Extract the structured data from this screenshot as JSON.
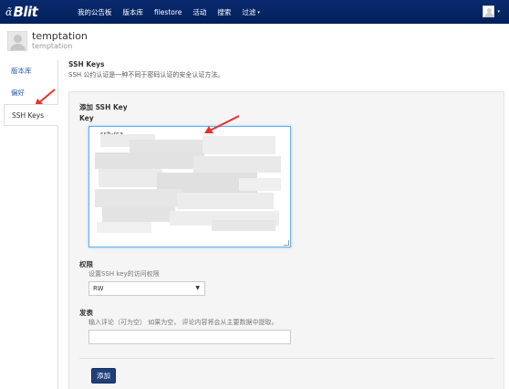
{
  "navbar": {
    "brand_mark": "ɑ̃",
    "brand_text": "Blit",
    "links": [
      "我的公告板",
      "版本库",
      "filestore",
      "活动",
      "搜索"
    ],
    "dropdown_label": "过滤",
    "caret": "▾"
  },
  "profile": {
    "name": "temptation",
    "subname": "temptation"
  },
  "sidenav": {
    "items": [
      "版本库",
      "偏好",
      "SSH Keys"
    ],
    "active_index": 2
  },
  "ssh": {
    "title": "SSH Keys",
    "description": "SSH 公约认证是一种不同于密码认证的安全认证方法。"
  },
  "form": {
    "card_title": "添加 SSH Key",
    "key_label": "Key",
    "key_value_visible": "ssh-rsa",
    "permission_label": "权限",
    "permission_hint": "设置SSH key的访问权限",
    "permission_value": "RW",
    "comment_label": "发表",
    "comment_hint": "输入评论（可为空） 如果为空， 评论内容将会从主要数据中提取。",
    "comment_value": "",
    "submit_label": "添加"
  },
  "colors": {
    "navbar": "#00205b",
    "accent_link": "#2a5db0",
    "button": "#1f3f7a",
    "annotation_arrow": "#e8312f"
  }
}
